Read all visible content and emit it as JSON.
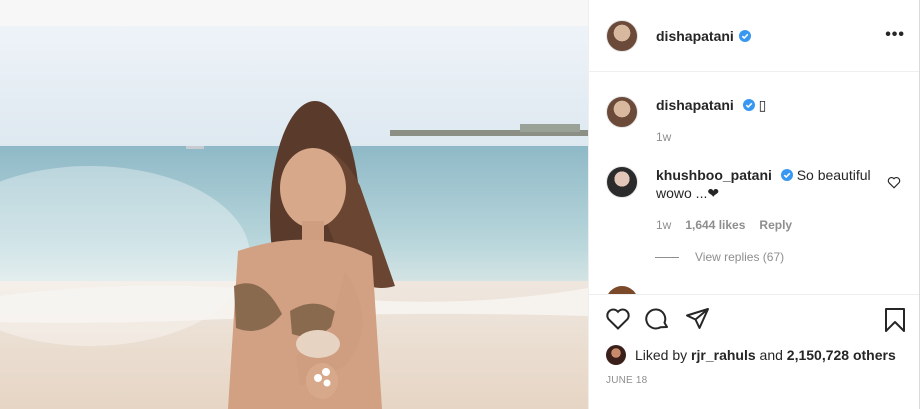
{
  "post": {
    "author": "dishapatani",
    "more_icon": "more-horizontal-icon",
    "caption_emoji": "▯",
    "caption_time": "1w",
    "comment": {
      "user": "khushboo_patani",
      "text": "So beautiful wowo ...❤",
      "time": "1w",
      "likes": "1,644 likes",
      "reply": "Reply"
    },
    "view_replies": "View replies (67)",
    "liked_by_prefix": "Liked by",
    "liked_by_user": "rjr_rahuls",
    "liked_by_and": "and",
    "liked_by_count": "2,150,728 others",
    "date": "JUNE 18"
  },
  "colors": {
    "verified": "#3897f0",
    "text": "#262626",
    "muted": "#8e8e8e"
  }
}
